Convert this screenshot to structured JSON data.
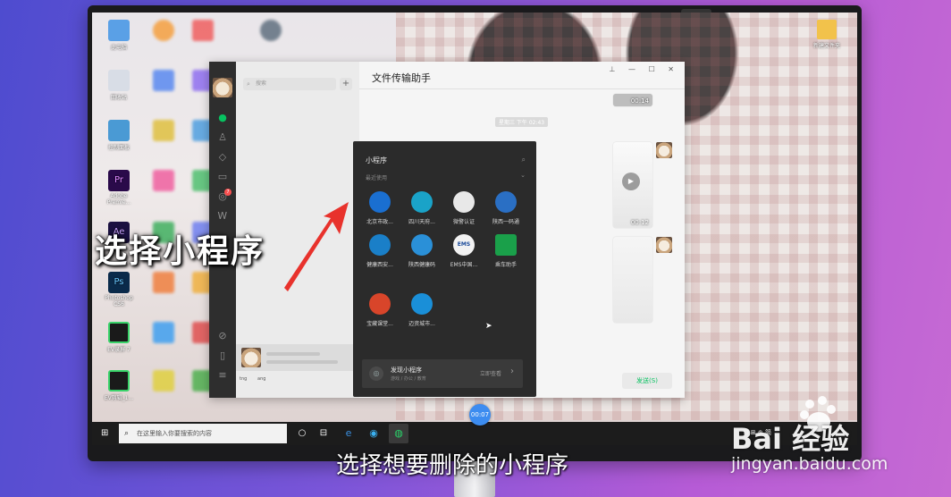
{
  "desktop": {
    "icons_left": [
      {
        "label": "此电脑",
        "color": "#5aa0e6"
      },
      {
        "label": "回收站",
        "color": "#d8dde6"
      },
      {
        "label": "控制面板",
        "color": "#4a9ad4"
      },
      {
        "label": "Adobe Premie...",
        "color": "#2a0a4a"
      },
      {
        "label": "",
        "color": "#1a1040"
      },
      {
        "label": "Photoshop CS6",
        "color": "#0a2a4a"
      },
      {
        "label": "EV录屏 7",
        "color": "#1a1a1a"
      },
      {
        "label": "EV剪辑_1...",
        "color": "#1a1a1a"
      }
    ],
    "icon_right_label": "新建文件夹"
  },
  "wechat": {
    "search_placeholder": "搜索",
    "add_symbol": "+",
    "chat_title": "文件传输助手",
    "window_controls": "⊥ — ☐ ✕",
    "timestamp": "星期三 下午 02:43",
    "video_durations": [
      "00:14",
      "00:12"
    ],
    "send_button": "发送(S)",
    "list_item_labels": [
      "tng",
      "ang"
    ],
    "sidebar_badge": "7"
  },
  "mini_program_panel": {
    "title": "小程序",
    "recent_label": "最近使用",
    "items": [
      {
        "label": "北京市政...",
        "color": "#1a6fd1"
      },
      {
        "label": "四川天府...",
        "color": "#1aa3c8"
      },
      {
        "label": "微警认证",
        "color": "#e8e8e8"
      },
      {
        "label": "陕西一码通",
        "color": "#2a6fc4"
      },
      {
        "label": "健康西安...",
        "color": "#1a7fc8"
      },
      {
        "label": "陕西健康码",
        "color": "#2a90d8"
      },
      {
        "label": "EMS中国...",
        "color": "#f2f2f2"
      },
      {
        "label": "乘车助手",
        "color": "#1aa04a"
      },
      {
        "label": "宝藏课堂...",
        "color": "#d8452a"
      },
      {
        "label": "迈资城市...",
        "color": "#1a8fd8"
      }
    ],
    "discover_title": "发现小程序",
    "discover_subtitle": "游戏 / 办公 / 教育",
    "discover_action": "立即查看"
  },
  "overlay": {
    "big_caption": "选择小程序",
    "subtitle": "选择想要删除的小程序",
    "timer": "00:07"
  },
  "taskbar": {
    "search_placeholder": "在这里输入你要搜索的内容",
    "tray_text": "⊡ ⊞ ⊕ 简"
  },
  "watermark": {
    "brand": "Bai 经验",
    "url": "jingyan.baidu.com"
  }
}
